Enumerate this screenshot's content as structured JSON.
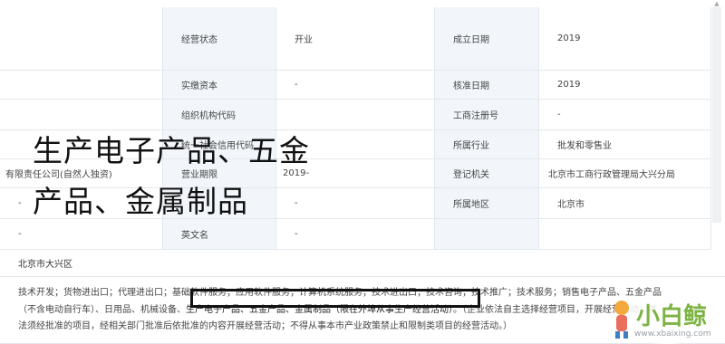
{
  "rows": [
    {
      "left_value": "",
      "label1": "经营状态",
      "value1": "开业",
      "label2": "成立日期",
      "value2": "2019"
    },
    {
      "left_value": "",
      "label1": "实缴资本",
      "value1": "-",
      "label2": "核准日期",
      "value2": "2019"
    },
    {
      "left_value": "",
      "label1": "组织机构代码",
      "value1": "",
      "label2": "工商注册号",
      "value2": "-"
    },
    {
      "left_value": "",
      "label1": "统一社会信用代码",
      "value1": "",
      "label2": "所属行业",
      "value2": "批发和零售业"
    },
    {
      "left_value": "有限责任公司(自然人独资)",
      "label1": "营业期限",
      "value1": "2019-",
      "label2": "登记机关",
      "value2": "北京市工商行政管理局大兴分局"
    },
    {
      "left_value": "-",
      "label1": "",
      "value1": "-",
      "label2": "所属地区",
      "value2": "北京市"
    },
    {
      "left_value": "-",
      "label1": "英文名",
      "value1": "-",
      "label2": "",
      "value2": ""
    }
  ],
  "address": "北京市大兴区",
  "business_scope": {
    "line1": "技术开发；货物进出口；代理进出口；基础软件服务；应用软件服务；计算机系统服务；技术进出口；技术咨询；技术推广；技术服务；销售电子产品、五金产品",
    "line2_prefix": "（不含电动自行车）、日用品、机械设备、",
    "line2_highlight": "生产电子产品、五金产品、金属制品（限在外埠从事生产经营活动）",
    "line2_suffix": "。（企业依法自主选择经营项目，开展经营活动；依",
    "line3": "法须经批准的项目，经相关部门批准后依批准的内容开展经营活动；不得从事本市产业政策禁止和限制类项目的经营活动。）"
  },
  "overlay": {
    "line1": "生产电子产品、五金",
    "line2": "产品、金属制品"
  },
  "watermark": {
    "logo_text": "小白鲸",
    "site": "www.xbaixing.com"
  }
}
